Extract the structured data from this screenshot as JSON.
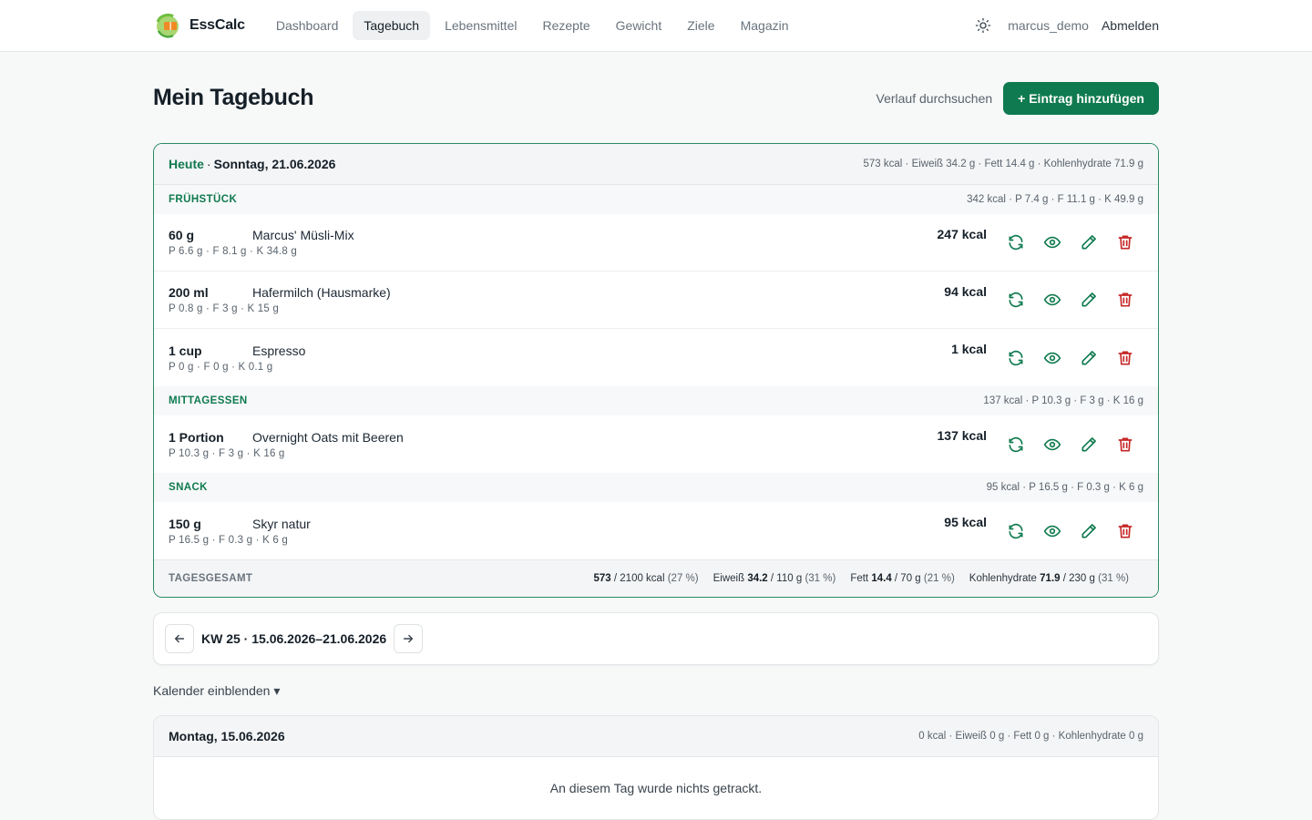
{
  "brand": {
    "name": "EssCalc"
  },
  "nav": {
    "items": [
      {
        "label": "Dashboard"
      },
      {
        "label": "Tagebuch"
      },
      {
        "label": "Lebensmittel"
      },
      {
        "label": "Rezepte"
      },
      {
        "label": "Gewicht"
      },
      {
        "label": "Ziele"
      },
      {
        "label": "Magazin"
      }
    ],
    "active": "Tagebuch"
  },
  "user": {
    "name": "marcus_demo",
    "logout": "Abmelden"
  },
  "page": {
    "title": "Mein Tagebuch",
    "search_history": "Verlauf durchsuchen",
    "add_entry": "+ Eintrag hinzufügen"
  },
  "today": {
    "label": "Heute",
    "separator": "·",
    "date": "Sonntag, 21.06.2026",
    "summary": "573 kcal · Eiweiß 34.2 g · Fett 14.4 g · Kohlenhydrate 71.9 g",
    "meals": [
      {
        "name": "FRÜHSTÜCK",
        "summary": "342 kcal · P 7.4 g · F 11.1 g · K 49.9 g",
        "entries": [
          {
            "qty": "60 g",
            "food": "Marcus' Müsli-Mix",
            "macros": "P 6.6 g · F 8.1 g · K 34.8 g",
            "kcal": "247 kcal"
          },
          {
            "qty": "200 ml",
            "food": "Hafermilch (Hausmarke)",
            "macros": "P 0.8 g · F 3 g · K 15 g",
            "kcal": "94 kcal"
          },
          {
            "qty": "1 cup",
            "food": "Espresso",
            "macros": "P 0 g · F 0 g · K 0.1 g",
            "kcal": "1 kcal"
          }
        ]
      },
      {
        "name": "MITTAGESSEN",
        "summary": "137 kcal · P 10.3 g · F 3 g · K 16 g",
        "entries": [
          {
            "qty": "1 Portion",
            "food": "Overnight Oats mit Beeren",
            "macros": "P 10.3 g · F 3 g · K 16 g",
            "kcal": "137 kcal"
          }
        ]
      },
      {
        "name": "SNACK",
        "summary": "95 kcal · P 16.5 g · F 0.3 g · K 6 g",
        "entries": [
          {
            "qty": "150 g",
            "food": "Skyr natur",
            "macros": "P 16.5 g · F 0.3 g · K 6 g",
            "kcal": "95 kcal"
          }
        ]
      }
    ],
    "total": {
      "label": "TAGESGESAMT",
      "kcal_value": "573",
      "kcal_rest": "/ 2100 kcal",
      "kcal_pct": "(27 %)",
      "protein_label": "Eiweiß",
      "protein_value": "34.2",
      "protein_rest": "/ 110 g",
      "protein_pct": "(31 %)",
      "fat_label": "Fett",
      "fat_value": "14.4",
      "fat_rest": "/ 70 g",
      "fat_pct": "(21 %)",
      "carb_label": "Kohlenhydrate",
      "carb_value": "71.9",
      "carb_rest": "/ 230 g",
      "carb_pct": "(31 %)"
    }
  },
  "week": {
    "label": "KW 25 · 15.06.2026–21.06.2026"
  },
  "calendar_toggle": "Kalender einblenden ▾",
  "monday": {
    "date": "Montag, 15.06.2026",
    "summary": "0 kcal · Eiweiß 0 g · Fett 0 g · Kohlenhydrate 0 g",
    "empty": "An diesem Tag wurde nichts getrackt."
  },
  "colors": {
    "accent": "#0f7a4f",
    "delete": "#c62828",
    "border_today": "#2b8a63"
  },
  "icons": {
    "row_actions": [
      "refresh-icon",
      "eye-icon",
      "pencil-icon",
      "trash-icon"
    ],
    "theme": "sun-icon",
    "week_prev": "arrow-left-icon",
    "week_next": "arrow-right-icon"
  }
}
